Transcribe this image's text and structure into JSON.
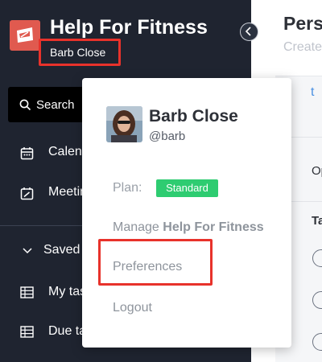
{
  "app": {
    "title": "Help For Fitness",
    "user_name": "Barb Close"
  },
  "sidebar": {
    "search_label": "Search",
    "items": [
      {
        "label": "Calendar",
        "icon": "calendar-icon"
      },
      {
        "label": "Meetings",
        "icon": "meeting-icon"
      },
      {
        "label": "Saved",
        "icon": "chevron-down-icon"
      },
      {
        "label": "My tasks",
        "icon": "table-icon"
      },
      {
        "label": "Due tasks",
        "icon": "table-icon"
      }
    ]
  },
  "main": {
    "title": "Pers",
    "subtitle": "Create",
    "tab": "t",
    "row_label_1": "Op",
    "row_label_2": "Ta"
  },
  "popup": {
    "name": "Barb Close",
    "handle": "@barb",
    "plan_label": "Plan:",
    "plan_value": "Standard",
    "manage_prefix": "Manage",
    "manage_workspace": "Help For Fitness",
    "preferences": "Preferences",
    "logout": "Logout"
  },
  "colors": {
    "accent_red": "#e8322b",
    "sidebar_bg": "#1f2430",
    "badge_green": "#2ecc71",
    "link_blue": "#4a90e2"
  }
}
